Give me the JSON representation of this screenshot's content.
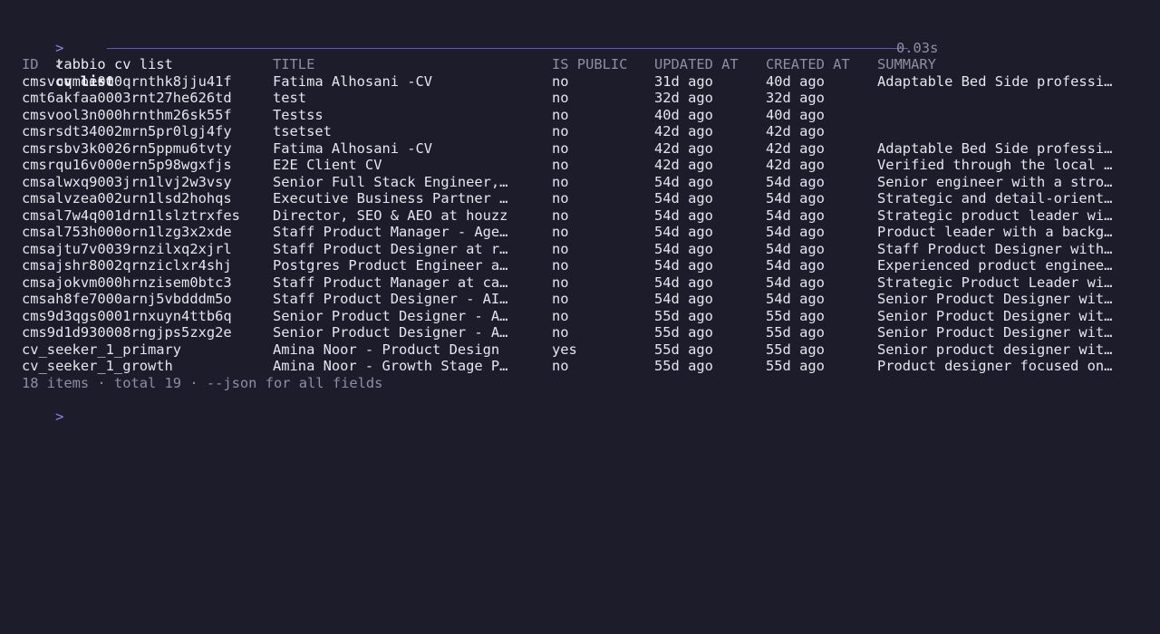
{
  "command": {
    "prompt_symbol": ">",
    "text": "tabbio cv list"
  },
  "status": {
    "check": "✓",
    "title": "cv list",
    "timing": "0.03s"
  },
  "table": {
    "headers": [
      "ID",
      "TITLE",
      "IS PUBLIC",
      "UPDATED AT",
      "CREATED AT",
      "SUMMARY"
    ],
    "rows": [
      [
        "cmsvoqmoe000qrnthk8jju41f",
        "Fatima Alhosani -CV",
        "no",
        "31d ago",
        "40d ago",
        "Adaptable Bed Side professi…"
      ],
      [
        "cmt6akfaa0003rnt27he626td",
        "test",
        "no",
        "32d ago",
        "32d ago",
        ""
      ],
      [
        "cmsvool3n000hrnthm26sk55f",
        "Testss",
        "no",
        "40d ago",
        "40d ago",
        ""
      ],
      [
        "cmsrsdt34002mrn5pr0lgj4fy",
        "tsetset",
        "no",
        "42d ago",
        "42d ago",
        ""
      ],
      [
        "cmsrsbv3k0026rn5ppmu6tvty",
        "Fatima Alhosani -CV",
        "no",
        "42d ago",
        "42d ago",
        "Adaptable Bed Side professi…"
      ],
      [
        "cmsrqu16v000ern5p98wgxfjs",
        "E2E Client CV",
        "no",
        "42d ago",
        "42d ago",
        "Verified through the local …"
      ],
      [
        "cmsalwxq9003jrn1lvj2w3vsy",
        "Senior Full Stack Engineer,…",
        "no",
        "54d ago",
        "54d ago",
        "Senior engineer with a stro…"
      ],
      [
        "cmsalvzea002urn1lsd2hohqs",
        "Executive Business Partner …",
        "no",
        "54d ago",
        "54d ago",
        "Strategic and detail-orient…"
      ],
      [
        "cmsal7w4q001drn1lslztrxfes",
        "Director, SEO & AEO at houzz",
        "no",
        "54d ago",
        "54d ago",
        "Strategic product leader wi…"
      ],
      [
        "cmsal753h000orn1lzg3x2xde",
        "Staff Product Manager - Age…",
        "no",
        "54d ago",
        "54d ago",
        "Product leader with a backg…"
      ],
      [
        "cmsajtu7v0039rnzilxq2xjrl",
        "Staff Product Designer at r…",
        "no",
        "54d ago",
        "54d ago",
        "Staff Product Designer with…"
      ],
      [
        "cmsajshr8002qrnziclxr4shj",
        "Postgres Product Engineer a…",
        "no",
        "54d ago",
        "54d ago",
        "Experienced product enginee…"
      ],
      [
        "cmsajokvm000hrnzisem0btc3",
        "Staff Product Manager at ca…",
        "no",
        "54d ago",
        "54d ago",
        "Strategic Product Leader wi…"
      ],
      [
        "cmsah8fe7000arnj5vbdddm5o",
        "Staff Product Designer - AI…",
        "no",
        "54d ago",
        "54d ago",
        "Senior Product Designer wit…"
      ],
      [
        "cms9d3qgs0001rnxuyn4ttb6q",
        "Senior Product Designer - A…",
        "no",
        "55d ago",
        "55d ago",
        "Senior Product Designer wit…"
      ],
      [
        "cms9d1d930008rngjps5zxg2e",
        "Senior Product Designer - A…",
        "no",
        "55d ago",
        "55d ago",
        "Senior Product Designer wit…"
      ],
      [
        "cv_seeker_1_primary",
        "Amina Noor - Product Design",
        "yes",
        "55d ago",
        "55d ago",
        "Senior product designer wit…"
      ],
      [
        "cv_seeker_1_growth",
        "Amina Noor - Growth Stage P…",
        "no",
        "55d ago",
        "55d ago",
        "Product designer focused on…"
      ]
    ]
  },
  "footer": "18 items · total 19 · --json for all fields",
  "next_prompt": ">",
  "colors": {
    "background": "#1c1c2a",
    "prompt": "#8a86e8",
    "rule": "#5b57c4",
    "muted": "#8e8ea0",
    "text": "#e6e6ee"
  }
}
